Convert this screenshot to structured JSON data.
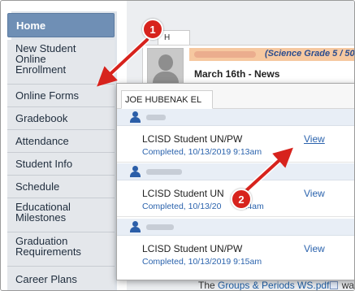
{
  "sidebar": {
    "items": [
      {
        "label": "Home"
      },
      {
        "label": "New Student Online Enrollment"
      },
      {
        "label": "Online Forms"
      },
      {
        "label": "Gradebook"
      },
      {
        "label": "Attendance"
      },
      {
        "label": "Student Info"
      },
      {
        "label": "Schedule"
      },
      {
        "label": "Educational Milestones"
      },
      {
        "label": "Graduation Requirements"
      },
      {
        "label": "Career Plans"
      }
    ]
  },
  "background": {
    "tab_label": "H",
    "science_label": "(Science Grade 5 / 50",
    "news_heading": "March 16th - News",
    "bottom_text_prefix": "The ",
    "bottom_text_link": "Groups & Periods WS.pdf",
    "bottom_text_suffix": " wa"
  },
  "popup": {
    "tab_label": "JOE HUBENAK EL",
    "forms": [
      {
        "title": "LCISD Student UN/PW",
        "status": "Completed, 10/13/2019 9:13am",
        "action": "View"
      },
      {
        "title": "LCISD Student UN",
        "status": "Completed, 10/13/20",
        "status_suffix": "14am",
        "action": "View"
      },
      {
        "title": "LCISD Student UN/PW",
        "status": "Completed, 10/13/2019 9:15am",
        "action": "View"
      }
    ]
  },
  "annotations": {
    "callout1": "1",
    "callout2": "2",
    "color": "#d7231d"
  },
  "colors": {
    "home_bg": "#6f8fb5",
    "link": "#2b63ad",
    "student_row": "#e8eef6"
  }
}
